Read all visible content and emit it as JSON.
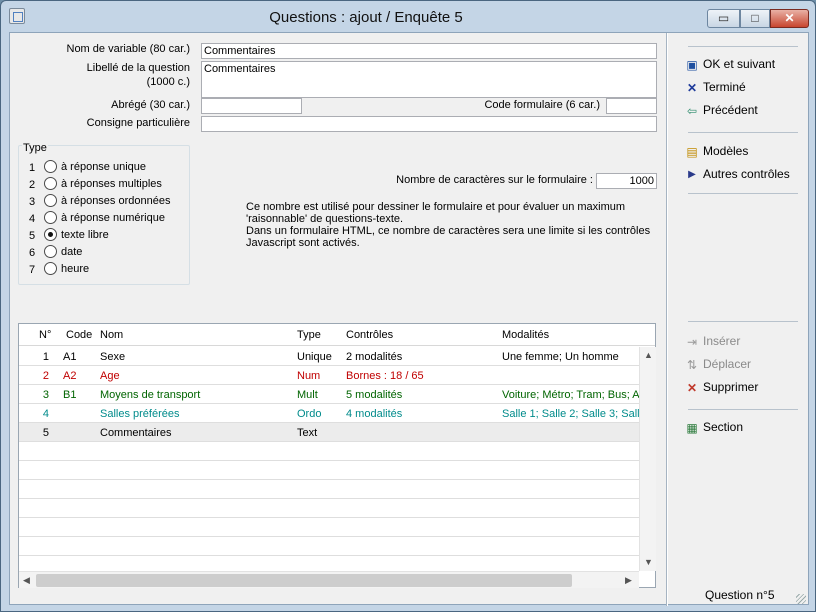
{
  "window": {
    "title": "Questions : ajout / Enquête 5",
    "min_glyph": "▭",
    "max_glyph": "□",
    "close_glyph": "✕"
  },
  "form": {
    "varname_label": "Nom de variable (80 car.)",
    "varname_value": "Commentaires",
    "libelle_label_1": "Libellé de la question",
    "libelle_label_2": "(1000 c.)",
    "libelle_value": "Commentaires",
    "abrege_label": "Abrégé (30 car.)",
    "abrege_value": "",
    "code_label": "Code formulaire  (6 car.)",
    "code_value": "",
    "consigne_label": "Consigne particulière",
    "consigne_value": ""
  },
  "type": {
    "title": "Type",
    "options": [
      {
        "num": "1",
        "label": "à réponse unique",
        "selected": false
      },
      {
        "num": "2",
        "label": "à réponses multiples",
        "selected": false
      },
      {
        "num": "3",
        "label": "à réponses ordonnées",
        "selected": false
      },
      {
        "num": "4",
        "label": "à réponse numérique",
        "selected": false
      },
      {
        "num": "5",
        "label": "texte libre",
        "selected": true
      },
      {
        "num": "6",
        "label": "date",
        "selected": false
      },
      {
        "num": "7",
        "label": "heure",
        "selected": false
      }
    ]
  },
  "nbchars": {
    "label": "Nombre de caractères sur le formulaire :",
    "value": "1000",
    "note": "Ce nombre est utilisé pour dessiner le formulaire et pour évaluer un maximum\n'raisonnable' de questions-texte.\nDans un formulaire HTML, ce nombre de caractères sera une limite si les contrôles\nJavascript sont activés."
  },
  "actions": {
    "ok": "OK et suivant",
    "termine": "Terminé",
    "precedent": "Précédent",
    "modeles": "Modèles",
    "autres": "Autres contrôles",
    "inserer": "Insérer",
    "deplacer": "Déplacer",
    "supprimer": "Supprimer",
    "section": "Section"
  },
  "grid": {
    "headers": [
      "N°",
      "Code",
      "Nom",
      "Type",
      "Contrôles",
      "Modalités"
    ],
    "rows": [
      {
        "n": "1",
        "code": "A1",
        "nom": "Sexe",
        "type": "Unique",
        "controles": "2 modalités",
        "modalites": "Une femme; Un homme",
        "color": "#000000"
      },
      {
        "n": "2",
        "code": "A2",
        "nom": "Age",
        "type": "Num",
        "controles": "Bornes : 18 / 65",
        "modalites": "",
        "color": "#c00000"
      },
      {
        "n": "3",
        "code": "B1",
        "nom": "Moyens de transport",
        "type": "Mult",
        "controles": "5 modalités",
        "modalites": "Voiture; Métro; Tram; Bus; A",
        "color": "#006400"
      },
      {
        "n": "4",
        "code": "",
        "nom": "Salles préférées",
        "type": "Ordo",
        "controles": "4 modalités",
        "modalites": "Salle 1; Salle 2; Salle 3; Salle",
        "color": "#008b8b"
      },
      {
        "n": "5",
        "code": "",
        "nom": "Commentaires",
        "type": "Text",
        "controles": "",
        "modalites": "",
        "color": "#000000"
      }
    ]
  },
  "status": {
    "text": "Question n°5"
  }
}
